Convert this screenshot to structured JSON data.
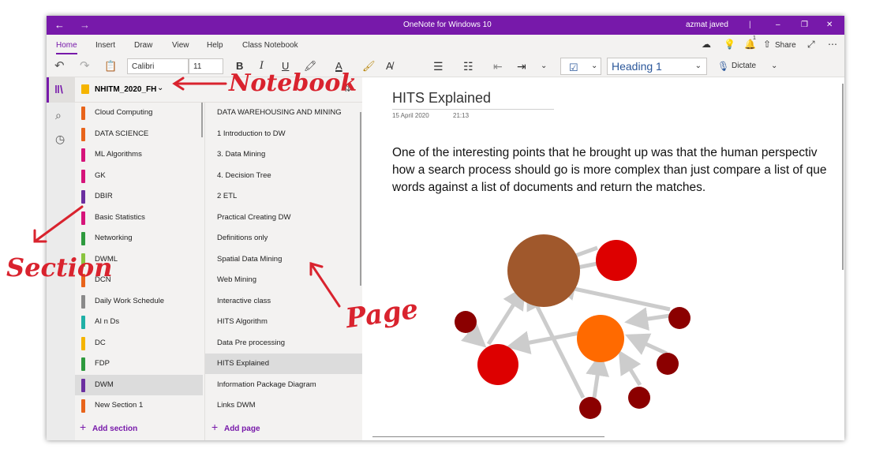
{
  "window": {
    "title": "OneNote for Windows 10",
    "user": "azmat javed",
    "back_glyph": "←",
    "forward_glyph": "→",
    "minimize_glyph": "–",
    "maximize_glyph": "❐",
    "close_glyph": "✕",
    "accent_color": "#7719aa"
  },
  "ribbon": {
    "tabs": [
      "Home",
      "Insert",
      "Draw",
      "View",
      "Help",
      "Class Notebook"
    ],
    "active_tab": "Home",
    "share_label": "Share",
    "notification_count": "1"
  },
  "toolbar": {
    "font_name": "Calibri",
    "font_size": "11",
    "bold": "B",
    "italic": "I",
    "underline": "U",
    "font_color_label": "A",
    "style": "Heading 1",
    "dictate_label": "Dictate"
  },
  "notebook": {
    "name": "NHITM_2020_FH"
  },
  "sections": {
    "items": [
      {
        "label": "Cloud Computing",
        "color": "#e8641b"
      },
      {
        "label": "DATA SCIENCE",
        "color": "#e8641b"
      },
      {
        "label": "ML Algorithms",
        "color": "#d6147a"
      },
      {
        "label": "GK",
        "color": "#d6147a"
      },
      {
        "label": "DBIR",
        "color": "#6b2fa0"
      },
      {
        "label": "Basic Statistics",
        "color": "#d6147a"
      },
      {
        "label": "Networking",
        "color": "#2e9a3e"
      },
      {
        "label": "DWML",
        "color": "#8ac43f"
      },
      {
        "label": "DCN",
        "color": "#e8641b"
      },
      {
        "label": "Daily Work Schedule",
        "color": "#8a8a8a"
      },
      {
        "label": "AI n Ds",
        "color": "#1fb0a6"
      },
      {
        "label": "DC",
        "color": "#f5b400"
      },
      {
        "label": "FDP",
        "color": "#2e9a3e"
      },
      {
        "label": "DWM",
        "color": "#6b2fa0"
      },
      {
        "label": "New Section 1",
        "color": "#e8641b"
      }
    ],
    "selected": "DWM",
    "add_label": "Add section"
  },
  "pages": {
    "items": [
      "DATA WAREHOUSING AND MINING",
      "1 Introduction to DW",
      "3. Data Mining",
      "4. Decision Tree",
      "2 ETL",
      "Practical Creating DW",
      "Definitions only",
      "Spatial Data Mining",
      "Web Mining",
      "Interactive class",
      "HITS Algorithm",
      "Data Pre processing",
      "HITS Explained",
      "Information Package Diagram",
      "Links DWM"
    ],
    "selected": "HITS Explained",
    "add_label": "Add page"
  },
  "page": {
    "title": "HITS Explained",
    "date": "15 April 2020",
    "time": "21:13",
    "lines": [
      "One of the interesting points that he brought up was that the human perspectiv",
      "how a search process should go is more complex than just compare a list of que",
      "words against a list of documents and return the matches."
    ]
  },
  "annotations": {
    "notebook": "Notebook",
    "section": "Section",
    "page": "Page",
    "color": "#d9232e"
  },
  "diagram": {
    "node_colors": {
      "central": "#a0582c",
      "hub": "#ff6a00",
      "authority": "#dd0000",
      "small": "#8b0000"
    },
    "edge_color": "#cccccc"
  }
}
